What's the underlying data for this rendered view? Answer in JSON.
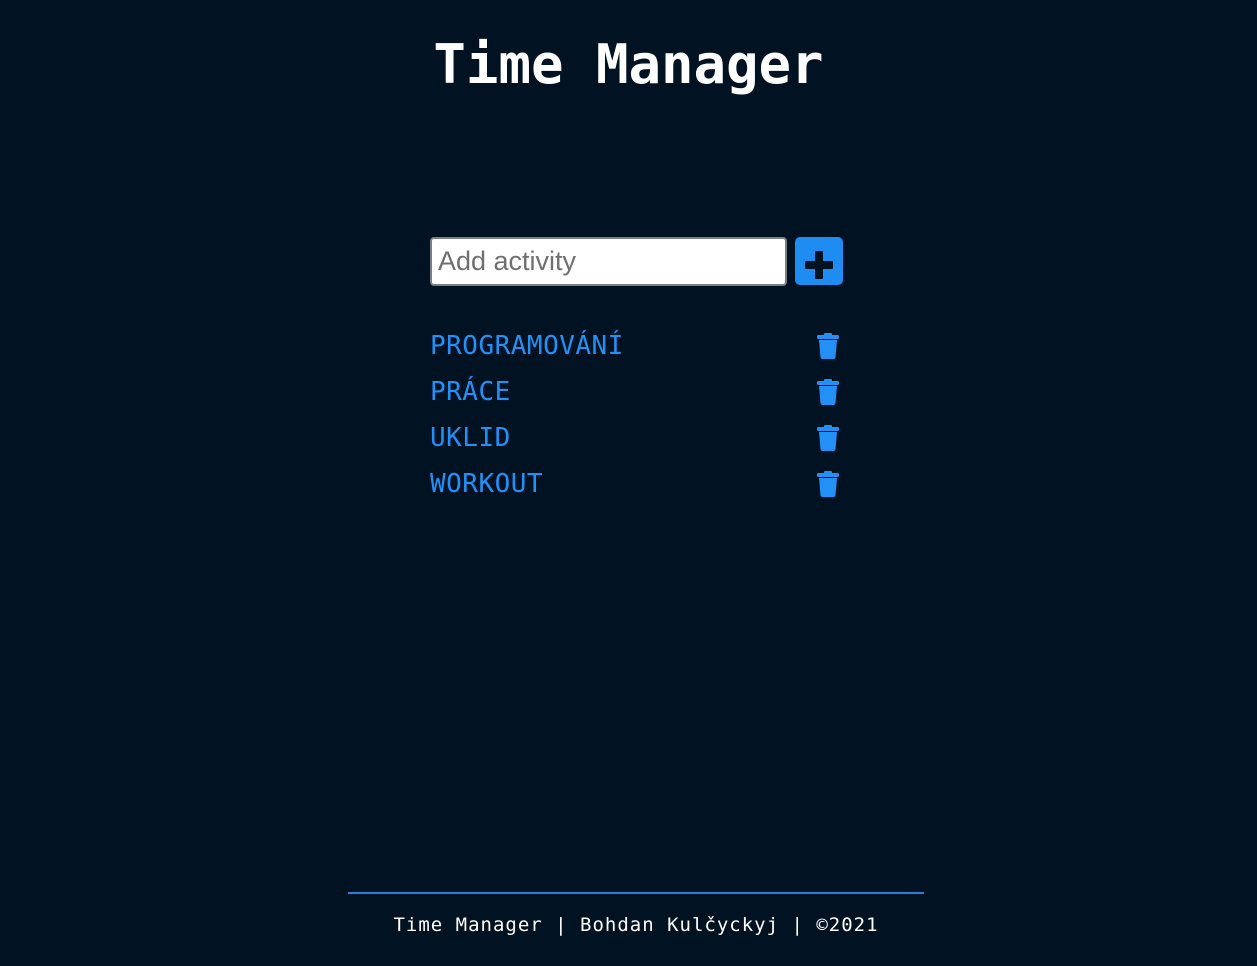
{
  "header": {
    "title": "Time Manager"
  },
  "add_form": {
    "input_placeholder": "Add activity",
    "input_value": "",
    "add_icon": "plus-icon"
  },
  "activities": [
    {
      "label": "PROGRAMOVÁNÍ",
      "delete_icon": "trash-icon"
    },
    {
      "label": "PRÁCE",
      "delete_icon": "trash-icon"
    },
    {
      "label": "UKLID",
      "delete_icon": "trash-icon"
    },
    {
      "label": "WORKOUT",
      "delete_icon": "trash-icon"
    }
  ],
  "footer": {
    "text": "Time Manager | Bohdan Kulčyckyj | ©2021"
  },
  "colors": {
    "background": "#011222",
    "accent": "#1e8cf0",
    "activity_text": "#2390f5",
    "title_text": "#ffffff"
  }
}
